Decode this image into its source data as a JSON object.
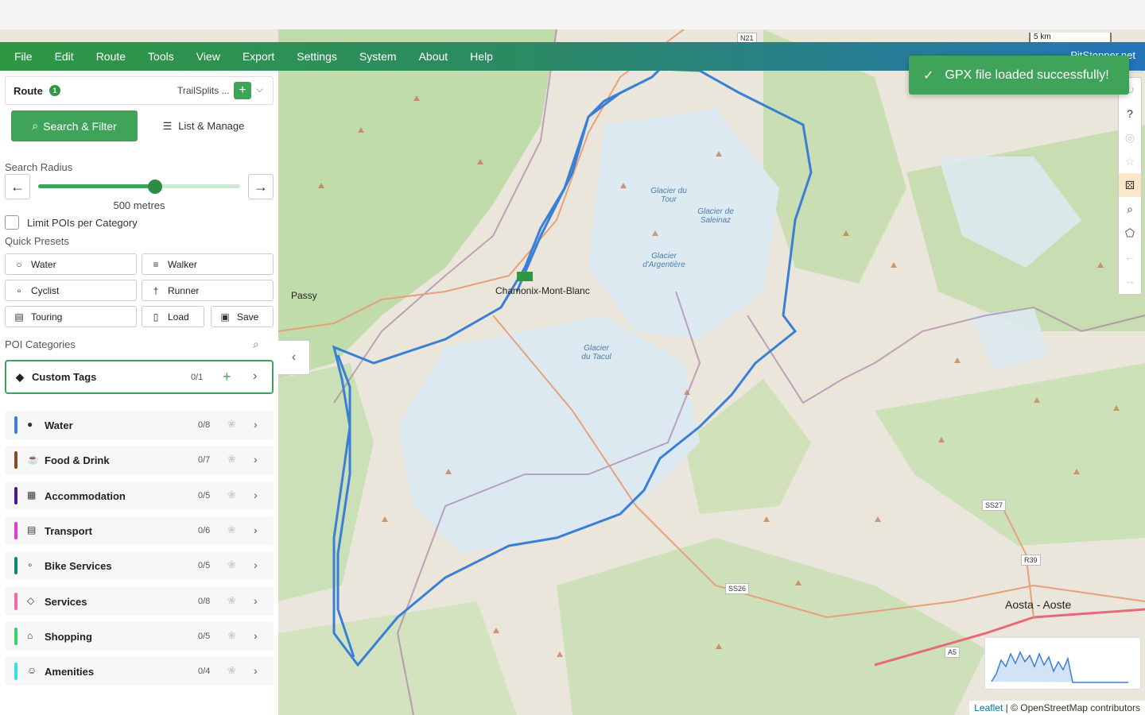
{
  "menu": {
    "items": [
      "File",
      "Edit",
      "Route",
      "Tools",
      "View",
      "Export",
      "Settings",
      "System",
      "About",
      "Help"
    ],
    "user": "PitStopper.net"
  },
  "toast": {
    "message": "GPX file loaded successfully!"
  },
  "route": {
    "label": "Route",
    "count": "1",
    "name": "TrailSplits ..."
  },
  "tabs": {
    "search": "Search & Filter",
    "list": "List & Manage"
  },
  "search_radius": {
    "label": "Search Radius",
    "value_text": "500 metres",
    "fraction": 0.58
  },
  "limit_pois": {
    "label": "Limit POIs per Category",
    "checked": false
  },
  "quick_presets": {
    "label": "Quick Presets",
    "items": [
      {
        "label": "Water",
        "icon": "water-drop-icon"
      },
      {
        "label": "Walker",
        "icon": "walker-icon"
      },
      {
        "label": "Cyclist",
        "icon": "bicycle-icon"
      },
      {
        "label": "Runner",
        "icon": "runner-icon"
      },
      {
        "label": "Touring",
        "icon": "bus-icon"
      },
      {
        "label": "Load",
        "icon": "load-icon"
      },
      {
        "label": "Save",
        "icon": "save-icon"
      }
    ]
  },
  "poi": {
    "label": "POI Categories",
    "custom_tags": {
      "label": "Custom Tags",
      "count": "0/1"
    },
    "categories": [
      {
        "name": "Water",
        "count": "0/8",
        "color": "#3f7fd0",
        "icon": "drop-icon"
      },
      {
        "name": "Food & Drink",
        "count": "0/7",
        "color": "#8a4a1e",
        "icon": "cup-icon"
      },
      {
        "name": "Accommodation",
        "count": "0/5",
        "color": "#4b1a8a",
        "icon": "building-icon"
      },
      {
        "name": "Transport",
        "count": "0/6",
        "color": "#e23bd6",
        "icon": "bus-icon"
      },
      {
        "name": "Bike Services",
        "count": "0/5",
        "color": "#0e8a6a",
        "icon": "bicycle-icon"
      },
      {
        "name": "Services",
        "count": "0/8",
        "color": "#f06aa8",
        "icon": "shield-icon"
      },
      {
        "name": "Shopping",
        "count": "0/5",
        "color": "#34d26a",
        "icon": "cart-icon"
      },
      {
        "name": "Amenities",
        "count": "0/4",
        "color": "#34e0e6",
        "icon": "people-icon"
      }
    ]
  },
  "map": {
    "scale": "5 km",
    "attribution_leaflet": "Leaflet",
    "attribution_rest": " | © OpenStreetMap contributors",
    "labels": {
      "chamonix": "Chamonix-Mont-Blanc",
      "passy": "Passy",
      "aosta": "Aosta - Aoste",
      "glacier_tour": "Glacier du Tour",
      "glacier_saleinaz": "Glacier de Saleinaz",
      "glacier_argentiere": "Glacier d'Argentière",
      "glacier_tacul": "Glacier du Tacul"
    },
    "roads": [
      "N21",
      "SS27",
      "R39",
      "SS26",
      "A5"
    ]
  }
}
